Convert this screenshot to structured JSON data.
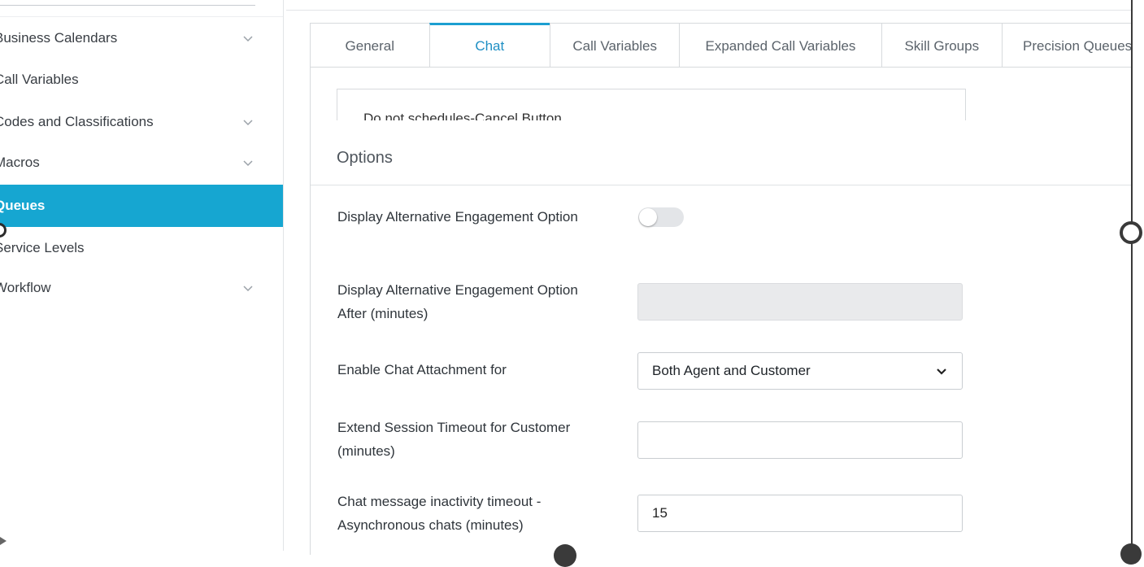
{
  "sidebar": {
    "items": [
      {
        "label": "Business Calendars",
        "has_chevron": true
      },
      {
        "label": "Call Variables",
        "has_chevron": false
      },
      {
        "label": "Codes and Classifications",
        "has_chevron": true
      },
      {
        "label": "Macros",
        "has_chevron": true
      },
      {
        "label": "Queues",
        "has_chevron": false,
        "active": true
      },
      {
        "label": "Service Levels",
        "has_chevron": false
      },
      {
        "label": "Workflow",
        "has_chevron": true
      }
    ],
    "active_color": "#16a6d1"
  },
  "tabs": [
    {
      "label": "General"
    },
    {
      "label": "Chat",
      "active": true
    },
    {
      "label": "Call Variables"
    },
    {
      "label": "Expanded Call Variables"
    },
    {
      "label": "Skill Groups"
    },
    {
      "label": "Precision Queues"
    }
  ],
  "clipped_list_item": "Do not schedules-Cancel Button",
  "options": {
    "title": "Options",
    "display_alt_engagement": {
      "label": "Display Alternative Engagement Option",
      "enabled": false
    },
    "display_alt_engagement_after": {
      "label": "Display Alternative Engagement Option After (minutes)",
      "value": "",
      "disabled": true
    },
    "chat_attachment": {
      "label": "Enable Chat Attachment for",
      "selected": "Both Agent and Customer"
    },
    "extend_session_timeout": {
      "label": "Extend Session Timeout for Customer (minutes)",
      "value": ""
    },
    "inactivity_timeout": {
      "label": "Chat message inactivity timeout - Asynchronous chats (minutes)",
      "value": "15"
    }
  },
  "colors": {
    "accent": "#1c9fd1",
    "active_tab_text": "#1f8fc4"
  }
}
